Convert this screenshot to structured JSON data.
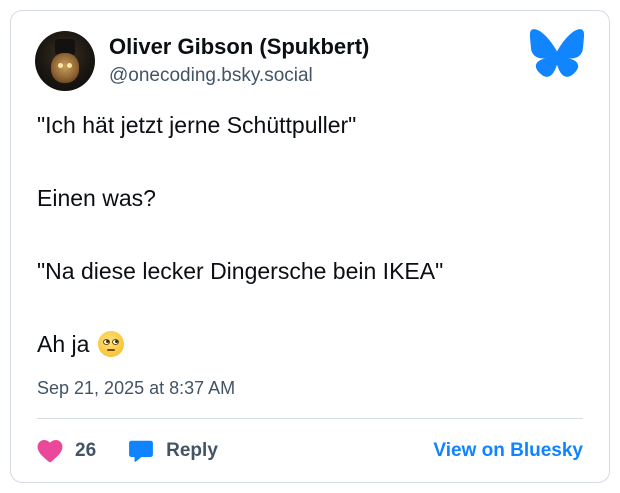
{
  "author": {
    "display_name": "Oliver Gibson (Spukbert)",
    "handle": "@onecoding.bsky.social"
  },
  "post": {
    "lines": [
      "\"Ich hät jetzt jerne Schüttpuller\"",
      "Einen was?",
      "\"Na diese lecker Dingersche bein IKEA\"",
      "Ah ja"
    ],
    "emoji": "face-with-rolling-eyes",
    "timestamp": "Sep 21, 2025 at 8:37 AM"
  },
  "actions": {
    "like_count": "26",
    "reply_label": "Reply",
    "view_label": "View on Bluesky"
  },
  "colors": {
    "brand": "#1083fe",
    "heart": "#ec4899",
    "muted": "#425466",
    "border": "#d4dbe2"
  },
  "icons": {
    "logo": "bluesky-butterfly-icon",
    "like": "heart-icon",
    "reply": "speech-bubble-icon"
  }
}
